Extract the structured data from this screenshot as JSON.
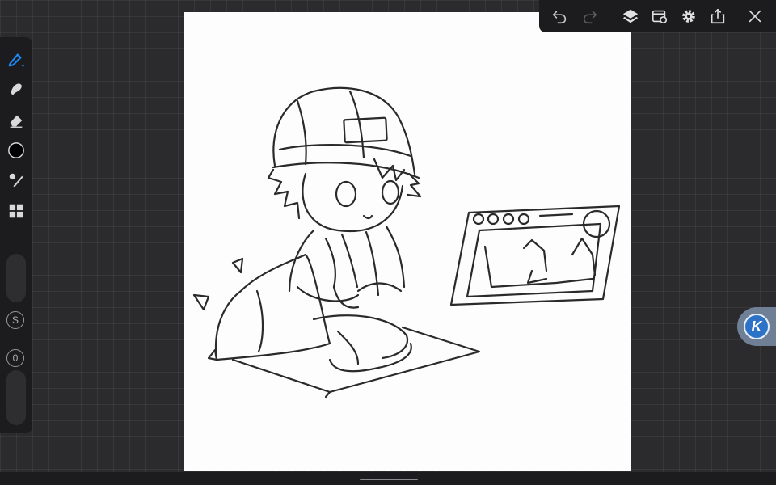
{
  "app": {
    "accent_color": "#1a8cff",
    "brush_color": "#000000"
  },
  "left_toolbar": {
    "tools": [
      "pen-icon",
      "smudge-icon",
      "eraser-icon",
      "color-picker-icon",
      "brush-library-icon",
      "gallery-icon"
    ],
    "size_label": "S",
    "opacity_label": "0"
  },
  "top_bar": {
    "buttons": [
      "undo-icon",
      "redo-icon",
      "layers-icon",
      "import-icon",
      "settings-icon",
      "share-icon",
      "close-icon"
    ]
  },
  "assist": {
    "label": "K"
  }
}
